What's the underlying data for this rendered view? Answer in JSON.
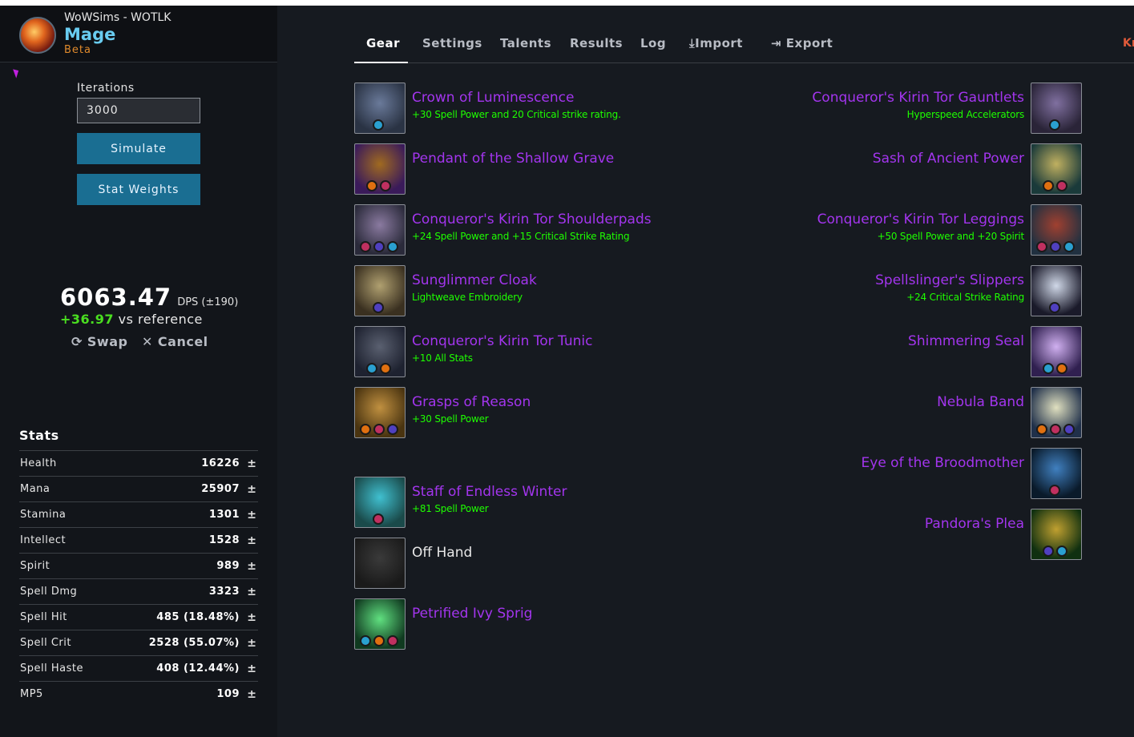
{
  "app": {
    "subtitle": "WoWSims - WOTLK",
    "title": "Mage",
    "badge": "Beta"
  },
  "sidebar": {
    "iterations_label": "Iterations",
    "iterations_value": "3000",
    "simulate_label": "Simulate",
    "stat_weights_label": "Stat Weights",
    "dps_value": "6063.47",
    "dps_unit": "DPS (±190)",
    "dps_diff": "+36.97",
    "dps_diff_suffix": "vs reference",
    "swap_label": "Swap",
    "cancel_label": "Cancel",
    "stats_title": "Stats",
    "stats": [
      {
        "name": "Health",
        "value": "16226"
      },
      {
        "name": "Mana",
        "value": "25907"
      },
      {
        "name": "Stamina",
        "value": "1301"
      },
      {
        "name": "Intellect",
        "value": "1528"
      },
      {
        "name": "Spirit",
        "value": "989"
      },
      {
        "name": "Spell Dmg",
        "value": "3323"
      },
      {
        "name": "Spell Hit",
        "value": "485 (18.48%)"
      },
      {
        "name": "Spell Crit",
        "value": "2528 (55.07%)"
      },
      {
        "name": "Spell Haste",
        "value": "408 (12.44%)"
      },
      {
        "name": "MP5",
        "value": "109"
      }
    ],
    "stat_modifier_symbol": "±"
  },
  "tabs": [
    "Gear",
    "Settings",
    "Talents",
    "Results",
    "Log",
    "Import",
    "Export"
  ],
  "active_tab": "Gear",
  "truncated_right_text": "Kr",
  "gear_left": [
    {
      "name": "Crown of Luminescence",
      "enchant": "+30 Spell Power and 20 Critical strike rating.",
      "icon": "hood-icon"
    },
    {
      "name": "Pendant of the Shallow Grave",
      "enchant": "",
      "icon": "necklace-icon"
    },
    {
      "name": "Conqueror's Kirin Tor Shoulderpads",
      "enchant": "+24 Spell Power and +15 Critical Strike Rating",
      "icon": "shoulder-icon"
    },
    {
      "name": "Sunglimmer Cloak",
      "enchant": "Lightweave Embroidery",
      "icon": "cloak-icon"
    },
    {
      "name": "Conqueror's Kirin Tor Tunic",
      "enchant": "+10 All Stats",
      "icon": "chest-icon"
    },
    {
      "name": "Grasps of Reason",
      "enchant": "+30 Spell Power",
      "icon": "bracer-icon"
    },
    {
      "name": "Staff of Endless Winter",
      "enchant": "+81 Spell Power",
      "icon": "staff-icon"
    },
    {
      "name": "Off Hand",
      "enchant": "",
      "icon": "offhand-empty-icon"
    },
    {
      "name": "Petrified Ivy Sprig",
      "enchant": "",
      "icon": "wand-icon"
    }
  ],
  "gear_right": [
    {
      "name": "Conqueror's Kirin Tor Gauntlets",
      "enchant": "Hyperspeed Accelerators",
      "icon": "gloves-icon"
    },
    {
      "name": "Sash of Ancient Power",
      "enchant": "",
      "icon": "belt-icon"
    },
    {
      "name": "Conqueror's Kirin Tor Leggings",
      "enchant": "+50 Spell Power and +20 Spirit",
      "icon": "legs-icon"
    },
    {
      "name": "Spellslinger's Slippers",
      "enchant": "+24 Critical Strike Rating",
      "icon": "boots-icon"
    },
    {
      "name": "Shimmering Seal",
      "enchant": "",
      "icon": "ring-icon"
    },
    {
      "name": "Nebula Band",
      "enchant": "",
      "icon": "ring-icon"
    },
    {
      "name": "Eye of the Broodmother",
      "enchant": "",
      "icon": "trinket-eye-icon"
    },
    {
      "name": "Pandora's Plea",
      "enchant": "",
      "icon": "trinket-orb-icon"
    }
  ],
  "colors": {
    "epic": "#a335ee",
    "enchant": "#1eff00",
    "accent": "#1a6e92",
    "class": "#69ccf0"
  }
}
